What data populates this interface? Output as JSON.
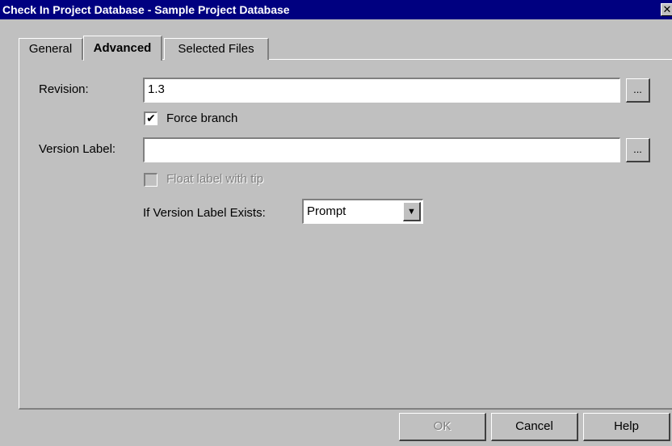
{
  "window": {
    "title": "Check In Project Database - Sample Project Database",
    "close_glyph": "✕"
  },
  "tabs": [
    {
      "label": "General",
      "active": false
    },
    {
      "label": "Advanced",
      "active": true
    },
    {
      "label": "Selected Files",
      "active": false
    }
  ],
  "form": {
    "revision_label": "Revision:",
    "revision_value": "1.3",
    "browse_label": "...",
    "force_branch_label": "Force branch",
    "force_branch_checked": "✔",
    "version_label_label": "Version Label:",
    "version_label_value": "",
    "float_label": "Float label with tip",
    "if_exists_label": "If Version Label Exists:",
    "if_exists_value": "Prompt",
    "dropdown_glyph": "▼"
  },
  "buttons": {
    "ok": "OK",
    "cancel": "Cancel",
    "help": "Help"
  },
  "colors": {
    "titlebar": "#000080",
    "face": "#c0c0c0"
  }
}
